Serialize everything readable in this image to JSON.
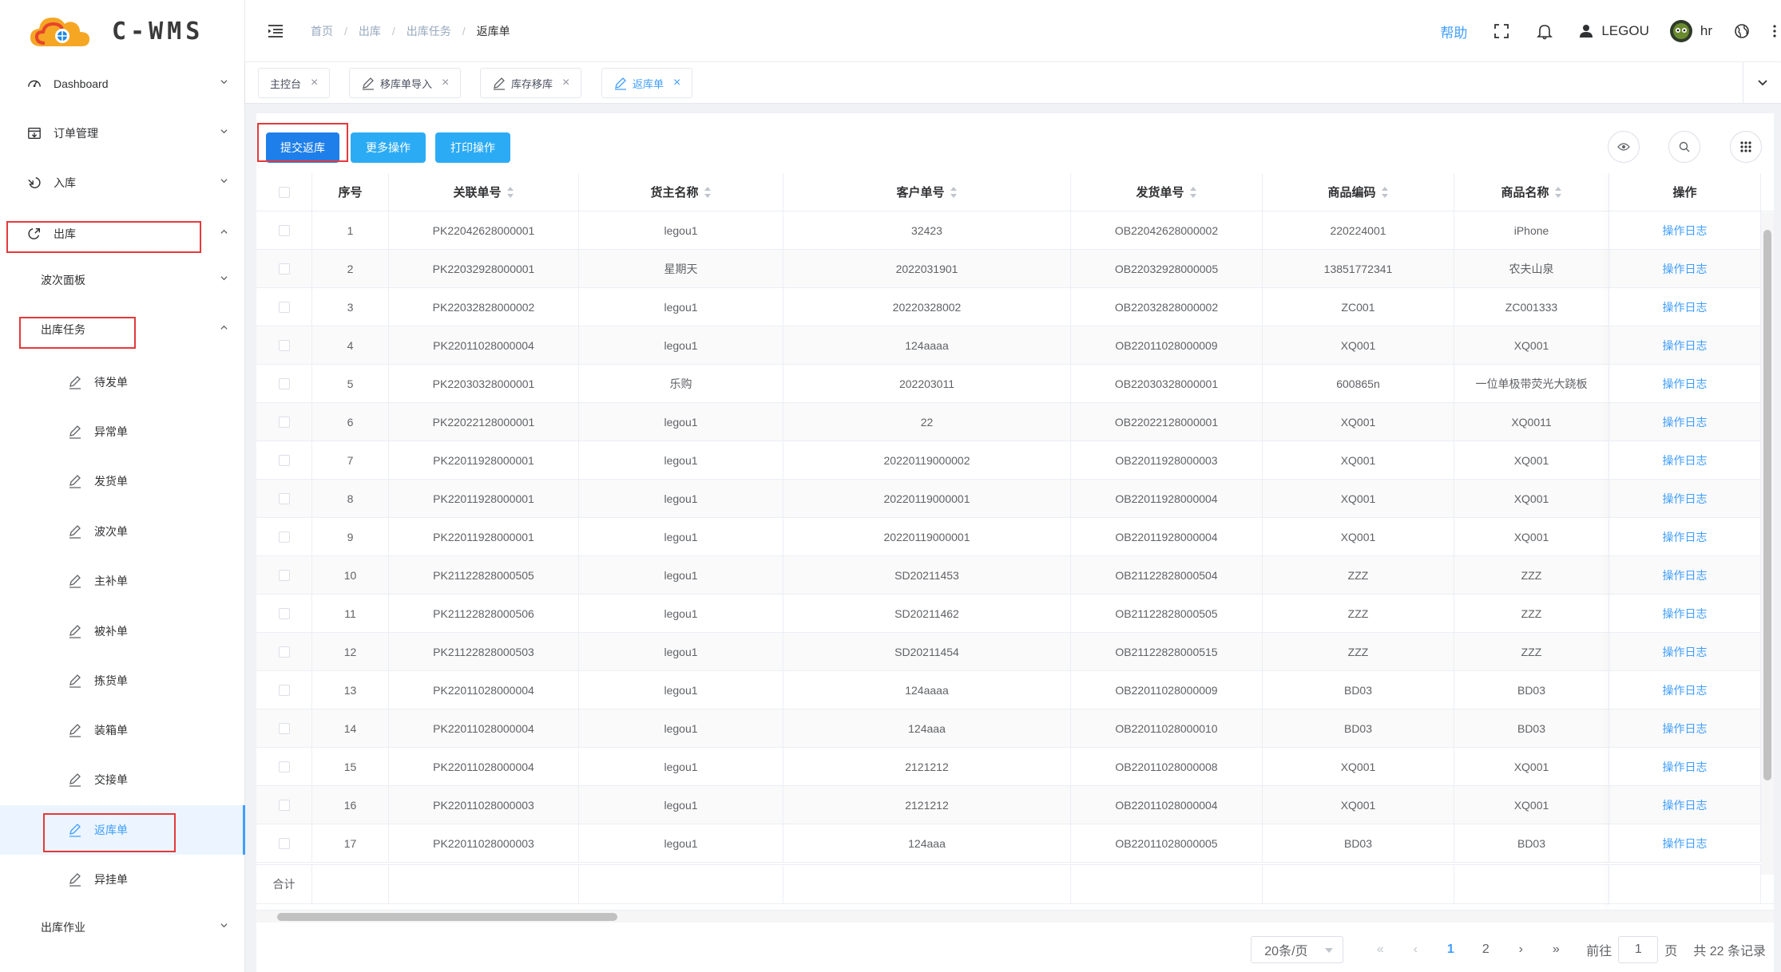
{
  "brand": {
    "logo_text": "C-WMS",
    "accent": "#409eff",
    "logo_colors": [
      "#f5a623",
      "#e8442b",
      "#1e88e5"
    ]
  },
  "sidebar": {
    "items": [
      {
        "label": "Dashboard",
        "icon": "dashboard-icon",
        "level": 1,
        "expanded": false
      },
      {
        "label": "订单管理",
        "icon": "order-icon",
        "level": 1,
        "expanded": false
      },
      {
        "label": "入库",
        "icon": "inbound-icon",
        "level": 1,
        "expanded": false
      },
      {
        "label": "出库",
        "icon": "outbound-icon",
        "level": 1,
        "expanded": true
      },
      {
        "label": "波次面板",
        "level": 2,
        "expanded": false
      },
      {
        "label": "出库任务",
        "level": 2,
        "expanded": true
      },
      {
        "label": "待发单",
        "icon": "edit-icon",
        "level": 3
      },
      {
        "label": "异常单",
        "icon": "edit-icon",
        "level": 3
      },
      {
        "label": "发货单",
        "icon": "edit-icon",
        "level": 3
      },
      {
        "label": "波次单",
        "icon": "edit-icon",
        "level": 3
      },
      {
        "label": "主补单",
        "icon": "edit-icon",
        "level": 3
      },
      {
        "label": "被补单",
        "icon": "edit-icon",
        "level": 3
      },
      {
        "label": "拣货单",
        "icon": "edit-icon",
        "level": 3
      },
      {
        "label": "装箱单",
        "icon": "edit-icon",
        "level": 3
      },
      {
        "label": "交接单",
        "icon": "edit-icon",
        "level": 3
      },
      {
        "label": "返库单",
        "icon": "edit-icon",
        "level": 3,
        "active": true
      },
      {
        "label": "异挂单",
        "icon": "edit-icon",
        "level": 3
      },
      {
        "label": "出库作业",
        "level": 2,
        "expanded": false
      }
    ]
  },
  "header": {
    "breadcrumb": [
      "首页",
      "出库",
      "出库任务",
      "返库单"
    ],
    "help": "帮助",
    "user": "LEGOU",
    "account": "hr"
  },
  "tags": [
    {
      "label": "主控台"
    },
    {
      "label": "移库单导入",
      "icon": "edit-icon"
    },
    {
      "label": "库存移库",
      "icon": "edit-icon"
    },
    {
      "label": "返库单",
      "icon": "edit-icon",
      "active": true
    }
  ],
  "toolbar": {
    "submit_label": "提交返库",
    "more_label": "更多操作",
    "print_label": "打印操作"
  },
  "table": {
    "columns": [
      "序号",
      "关联单号",
      "货主名称",
      "客户单号",
      "发货单号",
      "商品编码",
      "商品名称",
      "操作"
    ],
    "rows": [
      [
        "1",
        "PK22042628000001",
        "legou1",
        "32423",
        "OB22042628000002",
        "220224001",
        "iPhone",
        "操作日志"
      ],
      [
        "2",
        "PK22032928000001",
        "星期天",
        "2022031901",
        "OB22032928000005",
        "13851772341",
        "农夫山泉",
        "操作日志"
      ],
      [
        "3",
        "PK22032828000002",
        "legou1",
        "20220328002",
        "OB22032828000002",
        "ZC001",
        "ZC001333",
        "操作日志"
      ],
      [
        "4",
        "PK22011028000004",
        "legou1",
        "124aaaa",
        "OB22011028000009",
        "XQ001",
        "XQ001",
        "操作日志"
      ],
      [
        "5",
        "PK22030328000001",
        "乐购",
        "202203011",
        "OB22030328000001",
        "600865n",
        "一位单极带荧光大跷板",
        "操作日志"
      ],
      [
        "6",
        "PK22022128000001",
        "legou1",
        "22",
        "OB22022128000001",
        "XQ001",
        "XQ0011",
        "操作日志"
      ],
      [
        "7",
        "PK22011928000001",
        "legou1",
        "20220119000002",
        "OB22011928000003",
        "XQ001",
        "XQ001",
        "操作日志"
      ],
      [
        "8",
        "PK22011928000001",
        "legou1",
        "20220119000001",
        "OB22011928000004",
        "XQ001",
        "XQ001",
        "操作日志"
      ],
      [
        "9",
        "PK22011928000001",
        "legou1",
        "20220119000001",
        "OB22011928000004",
        "XQ001",
        "XQ001",
        "操作日志"
      ],
      [
        "10",
        "PK21122828000505",
        "legou1",
        "SD20211453",
        "OB21122828000504",
        "ZZZ",
        "ZZZ",
        "操作日志"
      ],
      [
        "11",
        "PK21122828000506",
        "legou1",
        "SD20211462",
        "OB21122828000505",
        "ZZZ",
        "ZZZ",
        "操作日志"
      ],
      [
        "12",
        "PK21122828000503",
        "legou1",
        "SD20211454",
        "OB21122828000515",
        "ZZZ",
        "ZZZ",
        "操作日志"
      ],
      [
        "13",
        "PK22011028000004",
        "legou1",
        "124aaaa",
        "OB22011028000009",
        "BD03",
        "BD03",
        "操作日志"
      ],
      [
        "14",
        "PK22011028000004",
        "legou1",
        "124aaa",
        "OB22011028000010",
        "BD03",
        "BD03",
        "操作日志"
      ],
      [
        "15",
        "PK22011028000004",
        "legou1",
        "2121212",
        "OB22011028000008",
        "XQ001",
        "XQ001",
        "操作日志"
      ],
      [
        "16",
        "PK22011028000003",
        "legou1",
        "2121212",
        "OB22011028000004",
        "XQ001",
        "XQ001",
        "操作日志"
      ],
      [
        "17",
        "PK22011028000003",
        "legou1",
        "124aaa",
        "OB22011028000005",
        "BD03",
        "BD03",
        "操作日志"
      ]
    ],
    "summary_label": "合计"
  },
  "pagination": {
    "page_size": "20条/页",
    "pages": [
      "1",
      "2"
    ],
    "current": "1",
    "goto_label": "前往",
    "goto_value": "1",
    "page_unit": "页",
    "total": "共 22 条记录"
  }
}
